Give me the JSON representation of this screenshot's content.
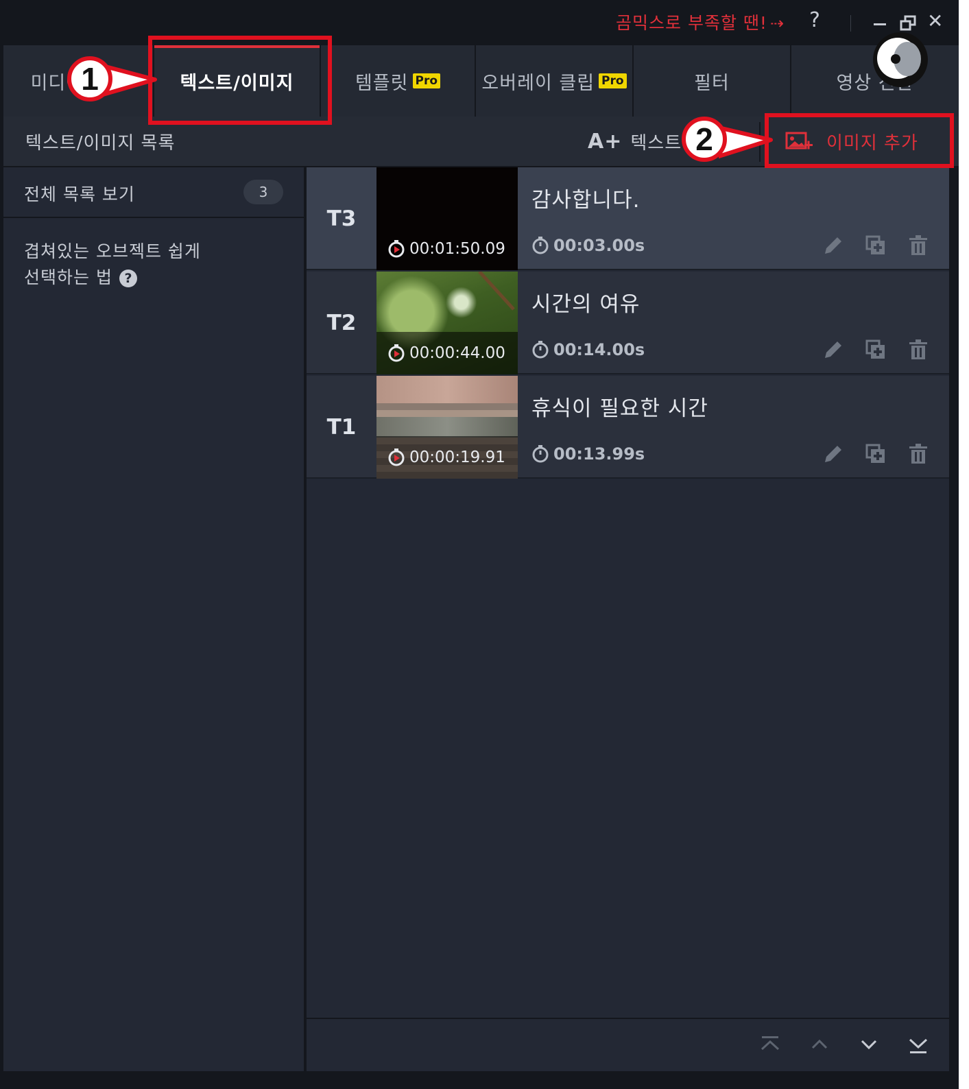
{
  "titlebar": {
    "promo_text": "곰믹스로 부족할 땐!",
    "promo_arrow": "⇢",
    "help": "?",
    "close": "✕"
  },
  "tabs": [
    {
      "label": "미디어 소스",
      "pro": ""
    },
    {
      "label": "텍스트/이미지",
      "pro": ""
    },
    {
      "label": "템플릿",
      "pro": "Pro"
    },
    {
      "label": "오버레이 클립",
      "pro": "Pro"
    },
    {
      "label": "필터",
      "pro": ""
    },
    {
      "label": "영상 전환",
      "pro": ""
    }
  ],
  "listbar": {
    "title": "텍스트/이미지 목록",
    "add_text_icon": "A+",
    "add_text_label": "텍스트 추가",
    "add_image_label": "이미지 추가"
  },
  "leftpanel": {
    "all_list_label": "전체 목록 보기",
    "all_list_count": "3",
    "tip_line1": "겹쳐있는 오브젝트 쉽게",
    "tip_line2": "선택하는 법",
    "tip_icon": "?"
  },
  "rows": [
    {
      "track": "T3",
      "start": "00:01:50.09",
      "name": "감사합니다.",
      "duration": "00:03.00s"
    },
    {
      "track": "T2",
      "start": "00:00:44.00",
      "name": "시간의 여유",
      "duration": "00:14.00s"
    },
    {
      "track": "T1",
      "start": "00:00:19.91",
      "name": "휴식이 필요한 시간",
      "duration": "00:13.99s"
    }
  ],
  "annotations": {
    "one": "1",
    "two": "2"
  },
  "colors": {
    "accent": "#e0303a",
    "annotation": "#e0111f",
    "pro_badge": "#f0d600"
  }
}
